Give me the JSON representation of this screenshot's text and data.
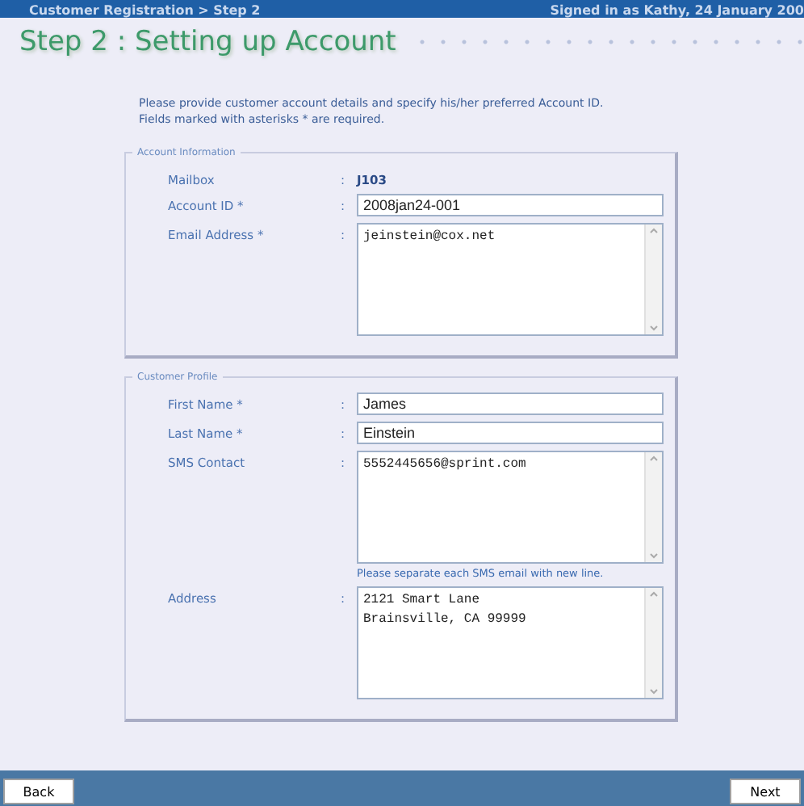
{
  "header": {
    "breadcrumb": "Customer Registration > Step 2",
    "signed_in": "Signed in as Kathy, 24 January 200"
  },
  "title": "Step 2 : Setting up Account",
  "intro": "Please provide customer account  details  and specify  his/her preferred Account ID. Fields marked with asterisks * are required.",
  "sections": [
    {
      "legend": "Account Information",
      "fields": [
        {
          "kind": "static",
          "label": "Mailbox",
          "separator": ":",
          "value": "J103"
        },
        {
          "kind": "input",
          "label": "Account ID *",
          "separator": ":",
          "value": "2008jan24-001"
        },
        {
          "kind": "textarea",
          "label": "Email Address *",
          "separator": ":",
          "value": "jeinstein@cox.net"
        }
      ]
    },
    {
      "legend": "Customer Profile",
      "fields": [
        {
          "kind": "input",
          "label": "First Name *",
          "separator": ":",
          "value": "James"
        },
        {
          "kind": "input",
          "label": "Last Name *",
          "separator": ":",
          "value": "Einstein"
        },
        {
          "kind": "textarea",
          "label": "SMS Contact",
          "separator": ":",
          "value": "5552445656@sprint.com",
          "note": "Please separate each SMS email with new line."
        },
        {
          "kind": "textarea",
          "label": "Address",
          "separator": ":",
          "value": "2121 Smart Lane\nBrainsville, CA 99999"
        }
      ]
    }
  ],
  "buttons": {
    "back": "Back",
    "next": "Next"
  }
}
